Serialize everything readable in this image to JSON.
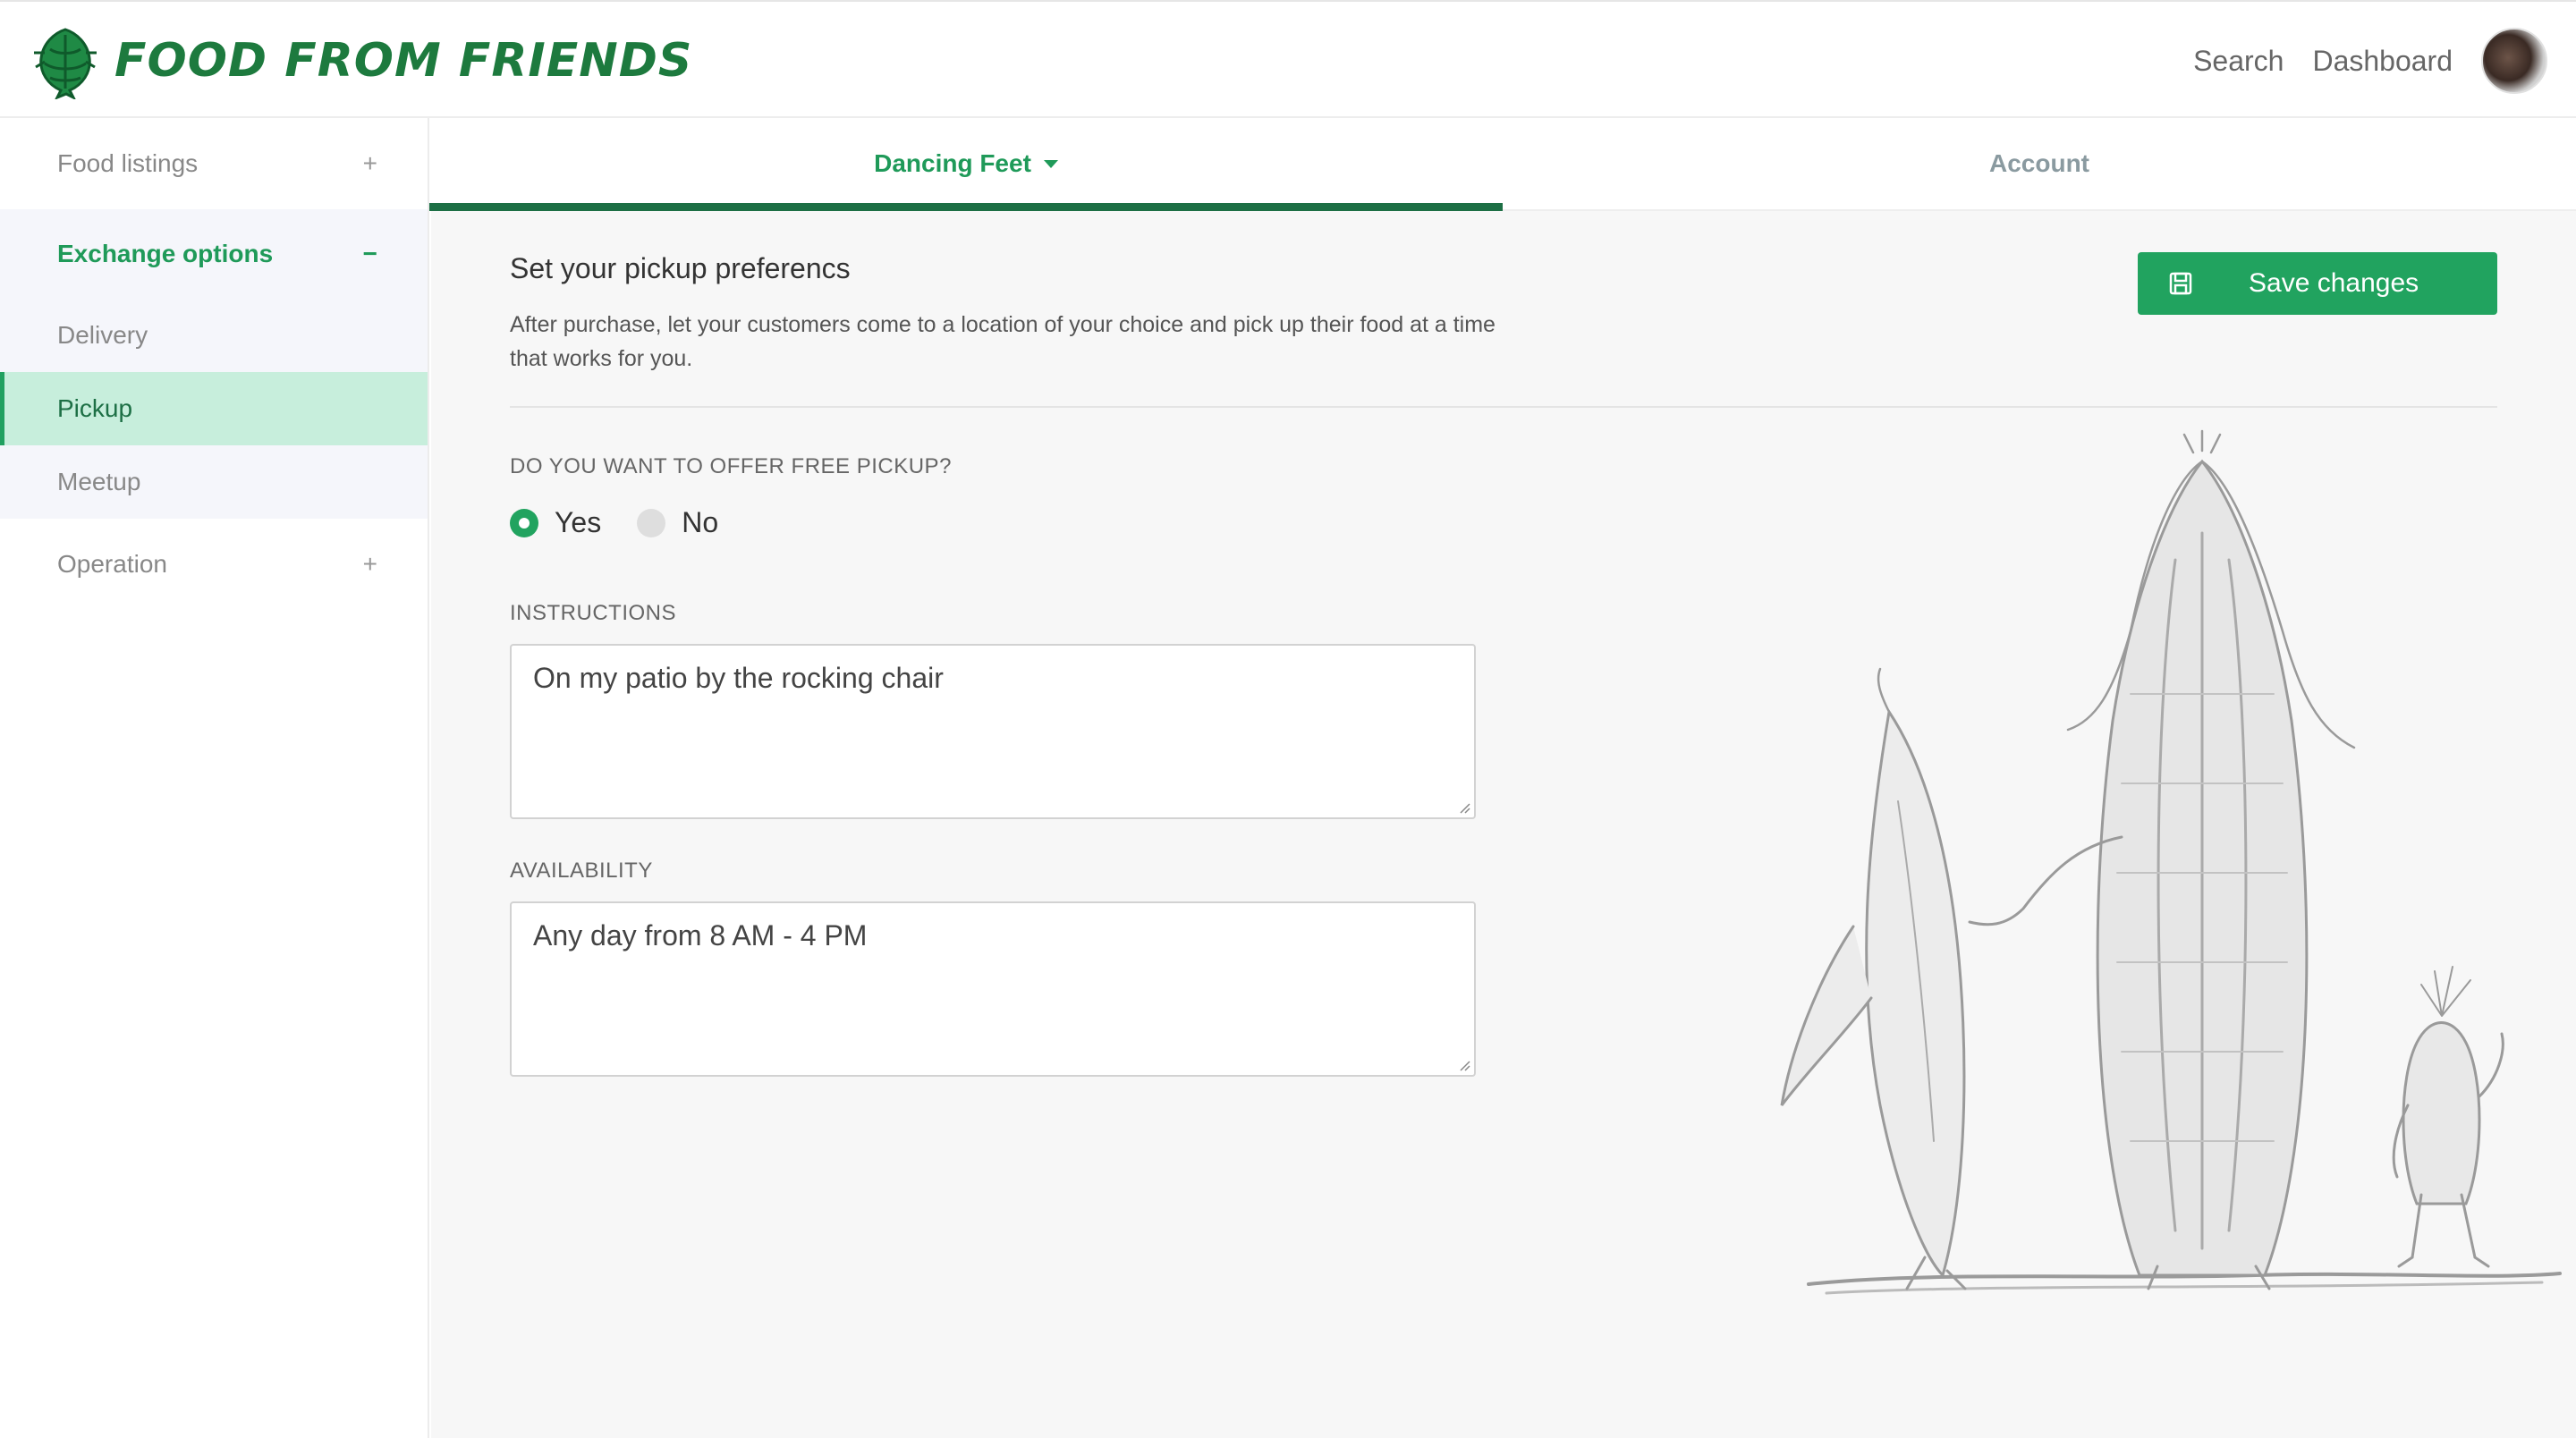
{
  "header": {
    "brand": "FOOD FROM FRIENDS",
    "nav": [
      "Search",
      "Dashboard"
    ]
  },
  "sidebar": {
    "food_listings": {
      "label": "Food listings",
      "toggle": "+"
    },
    "exchange_options": {
      "label": "Exchange options",
      "toggle": "−",
      "items": [
        "Delivery",
        "Pickup",
        "Meetup"
      ],
      "active": "Pickup"
    },
    "operation": {
      "label": "Operation",
      "toggle": "+"
    }
  },
  "tabs": [
    {
      "label": "Dancing Feet",
      "active": true
    },
    {
      "label": "Account",
      "active": false
    }
  ],
  "main": {
    "title": "Set your pickup preferencs",
    "description": "After purchase, let your customers come to a location of your choice and pick up their food at a time that works for you.",
    "save_label": "Save changes",
    "free_pickup_question": "DO YOU WANT TO OFFER FREE PICKUP?",
    "radio_yes": "Yes",
    "radio_no": "No",
    "free_pickup_selected": "Yes",
    "instructions_label": "INSTRUCTIONS",
    "instructions_value": "On my patio by the rocking chair",
    "availability_label": "AVAILABILITY",
    "availability_value": "Any day from 8 AM - 4 PM"
  },
  "colors": {
    "brand_green": "#1d7a3e",
    "accent_green": "#21a35f",
    "active_bg": "#c7eedc"
  }
}
